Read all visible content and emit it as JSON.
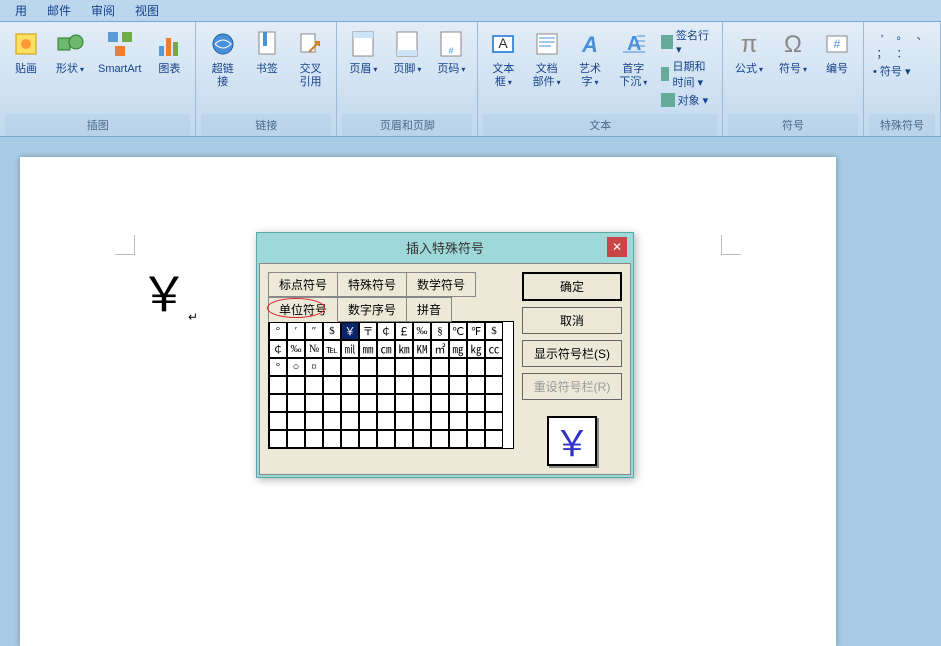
{
  "menu": [
    "用",
    "邮件",
    "审阅",
    "视图"
  ],
  "ribbon": {
    "groups": [
      {
        "label": "插图",
        "buttons": [
          {
            "label": "贴画",
            "icon": "clipart"
          },
          {
            "label": "形状",
            "icon": "shapes",
            "dd": true
          },
          {
            "label": "SmartArt",
            "icon": "smartart"
          },
          {
            "label": "图表",
            "icon": "chart"
          }
        ]
      },
      {
        "label": "链接",
        "buttons": [
          {
            "label": "超链接",
            "icon": "hyperlink"
          },
          {
            "label": "书签",
            "icon": "bookmark"
          },
          {
            "label": "交叉\n引用",
            "icon": "crossref"
          }
        ]
      },
      {
        "label": "页眉和页脚",
        "buttons": [
          {
            "label": "页眉",
            "icon": "header",
            "dd": true
          },
          {
            "label": "页脚",
            "icon": "footer",
            "dd": true
          },
          {
            "label": "页码",
            "icon": "pagenum",
            "dd": true
          }
        ]
      },
      {
        "label": "文本",
        "buttons": [
          {
            "label": "文本框",
            "icon": "textbox",
            "dd": true
          },
          {
            "label": "文档部件",
            "icon": "parts",
            "dd": true
          },
          {
            "label": "艺术字",
            "icon": "wordart",
            "dd": true
          },
          {
            "label": "首字下沉",
            "icon": "dropcap",
            "dd": true
          }
        ],
        "mini": [
          "签名行",
          "日期和时间",
          "对象"
        ]
      },
      {
        "label": "符号",
        "buttons": [
          {
            "label": "公式",
            "icon": "equation",
            "dd": true
          },
          {
            "label": "符号",
            "icon": "symbol",
            "dd": true
          },
          {
            "label": "编号",
            "icon": "number"
          }
        ]
      },
      {
        "label": "特殊符号",
        "buttons": [],
        "mini2": [
          ",",
          "。",
          "、",
          "；",
          "：",
          "符号"
        ]
      }
    ]
  },
  "doc_text": "￥",
  "dialog": {
    "title": "插入特殊符号",
    "tabs_row1": [
      "标点符号",
      "特殊符号",
      "数学符号"
    ],
    "tabs_row2": [
      "单位符号",
      "数字序号",
      "拼音"
    ],
    "active_tab_index": 3,
    "symbols": [
      "°",
      "′",
      "″",
      "$",
      "￥",
      "〒",
      "￠",
      "￡",
      "‰",
      "§",
      "℃",
      "℉",
      "$",
      "￠",
      "‰",
      "№",
      "℡",
      "㏕",
      "㎜",
      "㎝",
      "㎞",
      "㏎",
      "㎡",
      "㎎",
      "㎏",
      "㏄",
      "°",
      "○",
      "¤"
    ],
    "selected_symbol": "￥",
    "buttons": {
      "ok": "确定",
      "cancel": "取消",
      "show_bar": "显示符号栏(S)",
      "reset_bar": "重设符号栏(R)"
    }
  }
}
